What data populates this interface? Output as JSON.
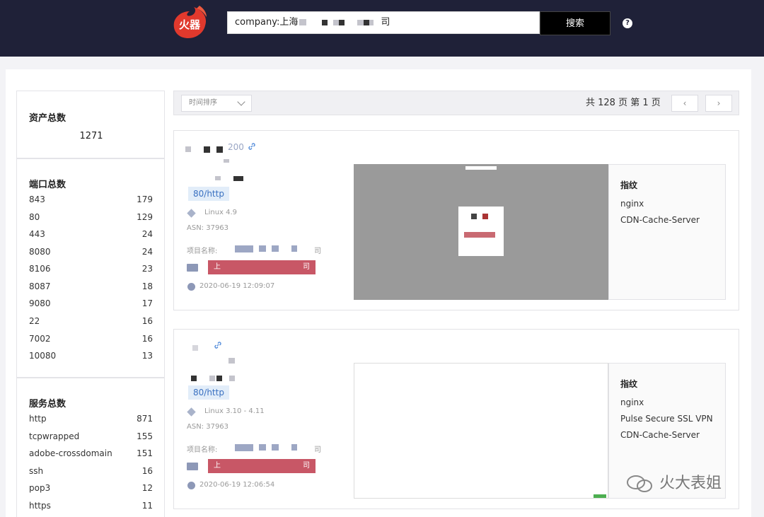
{
  "header": {
    "logo_text": "火器",
    "search_value": "company:上海",
    "search_suffix": "司",
    "search_button": "搜索",
    "help": "?"
  },
  "sidebar": {
    "assets": {
      "title": "资产总数",
      "total": "1271"
    },
    "ports": {
      "title": "端口总数",
      "items": [
        {
          "k": "843",
          "v": "179"
        },
        {
          "k": "80",
          "v": "129"
        },
        {
          "k": "443",
          "v": "24"
        },
        {
          "k": "8080",
          "v": "24"
        },
        {
          "k": "8106",
          "v": "23"
        },
        {
          "k": "8087",
          "v": "18"
        },
        {
          "k": "9080",
          "v": "17"
        },
        {
          "k": "22",
          "v": "16"
        },
        {
          "k": "7002",
          "v": "16"
        },
        {
          "k": "10080",
          "v": "13"
        }
      ]
    },
    "services": {
      "title": "服务总数",
      "items": [
        {
          "k": "http",
          "v": "871"
        },
        {
          "k": "tcpwrapped",
          "v": "155"
        },
        {
          "k": "adobe-crossdomain",
          "v": "151"
        },
        {
          "k": "ssh",
          "v": "16"
        },
        {
          "k": "pop3",
          "v": "12"
        },
        {
          "k": "https",
          "v": "11"
        }
      ]
    }
  },
  "toolbar": {
    "sort_label": "时间排序",
    "pager": "共 128 页  第 1 页",
    "prev": "‹",
    "next": "›"
  },
  "results": [
    {
      "status": "200",
      "tag": "80/http",
      "os": "Linux 4.9",
      "asn": "ASN: 37963",
      "project_label": "项目名称:",
      "project_suffix": "司",
      "banner_prefix": "上",
      "banner_suffix": "司",
      "time": "2020-06-19 12:09:07",
      "fp_title": "指纹",
      "fingerprints": [
        "nginx",
        "CDN-Cache-Server"
      ]
    },
    {
      "tag": "80/http",
      "os": "Linux 3.10 - 4.11",
      "asn": "ASN: 37963",
      "project_label": "项目名称:",
      "project_suffix": "司",
      "banner_prefix": "上",
      "banner_suffix": "司",
      "time": "2020-06-19 12:06:54",
      "fp_title": "指纹",
      "fingerprints": [
        "nginx",
        "Pulse Secure SSL VPN",
        "CDN-Cache-Server"
      ]
    }
  ],
  "watermark": "火大表姐",
  "colors": {
    "header_bg": "#1f2138",
    "banner": "#c85766",
    "tag_bg": "#e2edf9",
    "tag_text": "#3a71c1",
    "logo": "#e0392d"
  }
}
